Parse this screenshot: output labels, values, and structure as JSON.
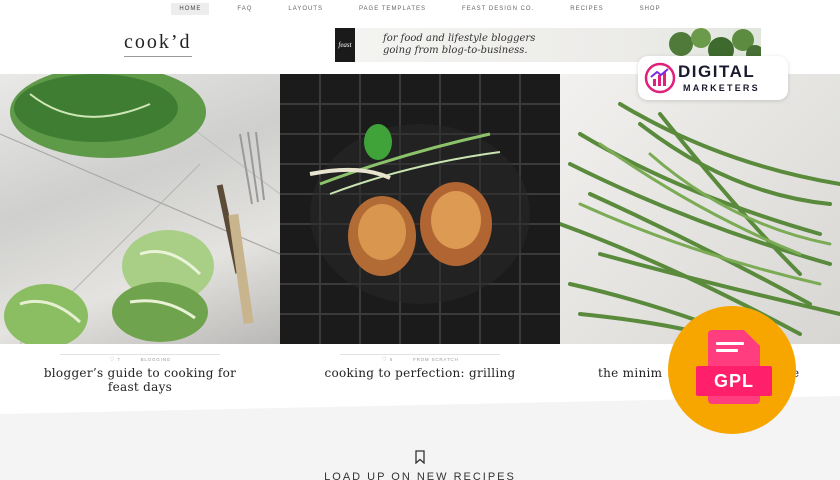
{
  "nav": {
    "items": [
      "HOME",
      "FAQ",
      "LAYOUTS",
      "PAGE TEMPLATES",
      "FEAST DESIGN CO.",
      "RECIPES",
      "SHOP"
    ],
    "active": "HOME"
  },
  "header": {
    "logo": "cook’d",
    "banner": {
      "badge": "feast",
      "line1": "for food and lifestyle bloggers",
      "line2": "going from blog-to-business."
    }
  },
  "posts": [
    {
      "likes": "7",
      "category": "BLOGGING",
      "title_line1": "blogger’s guide to cooking for",
      "title_line2": "feast days"
    },
    {
      "likes": "6",
      "category": "FROM SCRATCH",
      "title_line1": "cooking to perfection: grilling",
      "title_line2": ""
    },
    {
      "likes": "",
      "category": "",
      "title_line1": "the minim",
      "title_line2": ""
    }
  ],
  "post3_title_tail": "e",
  "load_more": "LOAD UP ON NEW RECIPES",
  "overlay": {
    "brand_line1": "DIGITAL",
    "brand_line2": "MARKETERS",
    "gpl": "GPL"
  },
  "colors": {
    "gpl_orange": "#f7a600",
    "gpl_pink": "#ff1f6b",
    "greens": "#5a8a3c"
  },
  "icons": [
    "heart-icon",
    "bookmark-icon",
    "chart-logo-icon",
    "document-icon"
  ]
}
